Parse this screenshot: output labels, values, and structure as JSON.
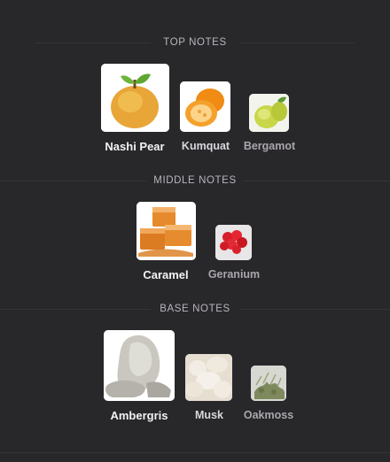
{
  "sections": [
    {
      "title": "TOP NOTES",
      "notes": [
        {
          "name": "Nashi Pear",
          "icon": "nashi-pear-image"
        },
        {
          "name": "Kumquat",
          "icon": "kumquat-image"
        },
        {
          "name": "Bergamot",
          "icon": "bergamot-image"
        }
      ]
    },
    {
      "title": "MIDDLE NOTES",
      "notes": [
        {
          "name": "Caramel",
          "icon": "caramel-image"
        },
        {
          "name": "Geranium",
          "icon": "geranium-image"
        }
      ]
    },
    {
      "title": "BASE NOTES",
      "notes": [
        {
          "name": "Ambergris",
          "icon": "ambergris-image"
        },
        {
          "name": "Musk",
          "icon": "musk-image"
        },
        {
          "name": "Oakmoss",
          "icon": "oakmoss-image"
        }
      ]
    }
  ]
}
